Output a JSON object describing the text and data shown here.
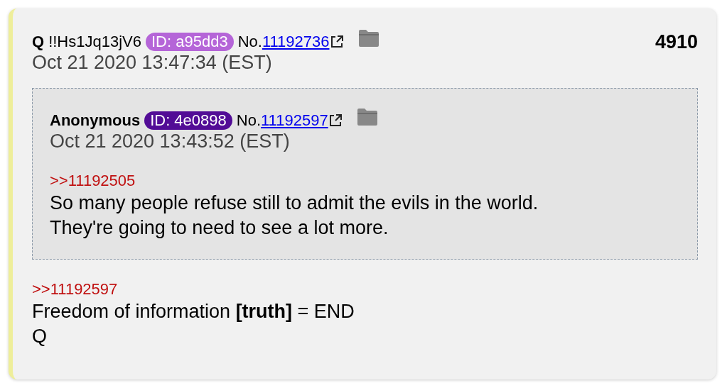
{
  "post": {
    "name": "Q",
    "tripcode": "!!Hs1Jq13jV6",
    "id_badge": {
      "text": "ID: a95dd3",
      "color": "#b565d8"
    },
    "number_prefix": "No.",
    "number": "11192736",
    "count": "4910",
    "date": "Oct 21 2020 13:47:34 (EST)",
    "quote": {
      "name": "Anonymous",
      "id_badge": {
        "text": "ID: 4e0898",
        "color": "#520c96"
      },
      "number_prefix": "No.",
      "number": "11192597",
      "date": "Oct 21 2020 13:43:52 (EST)",
      "reply_link": ">>11192505",
      "body": [
        "So many people refuse still to admit the evils in the world.",
        "They're going to need to see a lot more."
      ]
    },
    "reply_link": ">>11192597",
    "body": [
      "Freedom of information **[truth]** = END",
      "Q"
    ]
  }
}
